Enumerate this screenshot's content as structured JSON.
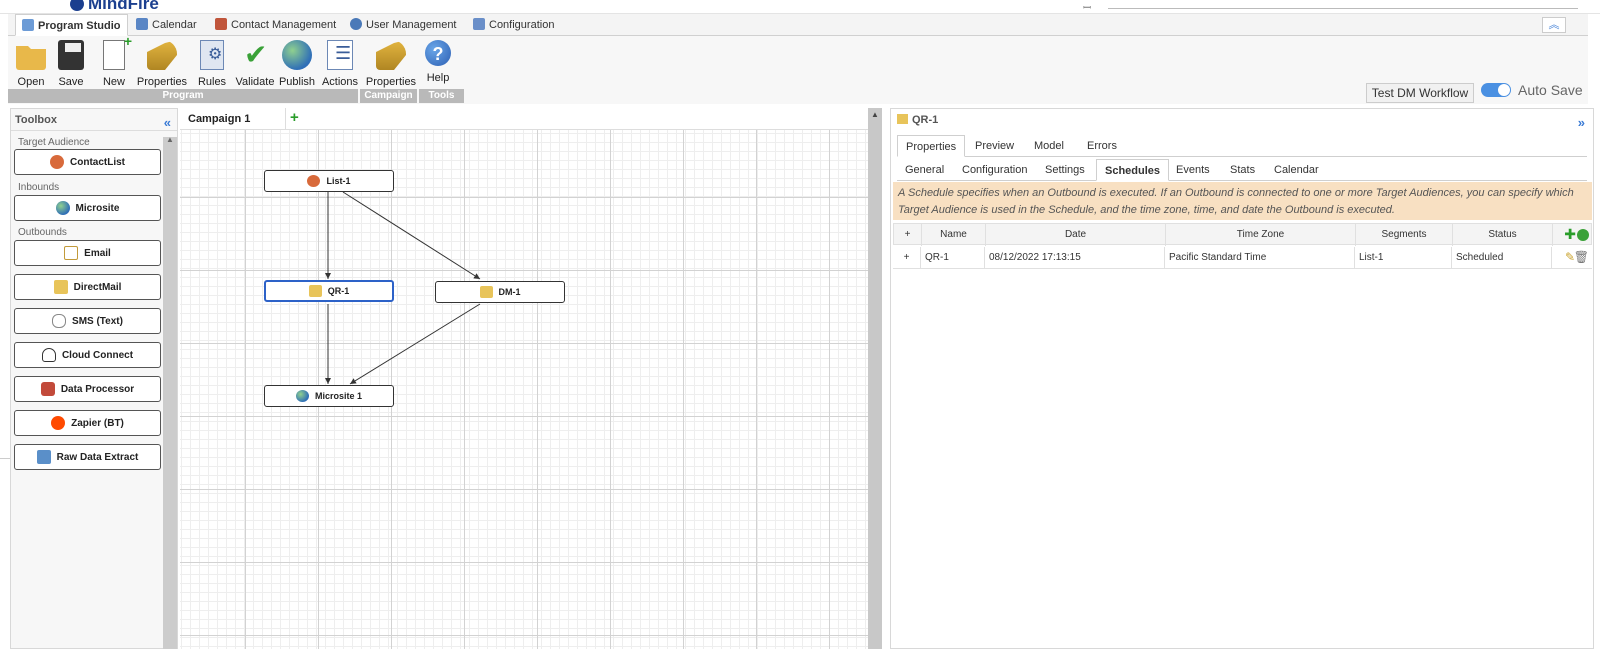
{
  "app": {
    "logo_text": "MindFire",
    "search_placeholder": ""
  },
  "top_tabs": [
    {
      "label": "Program Studio",
      "color": "#3a7bd5"
    },
    {
      "label": "Calendar",
      "color": "#5a86c5"
    },
    {
      "label": "Contact Management",
      "color": "#c0553b"
    },
    {
      "label": "User Management",
      "color": "#4a79b8"
    },
    {
      "label": "Configuration",
      "color": "#6a8fc9"
    }
  ],
  "ribbon": {
    "buttons": [
      {
        "label": "Open",
        "icon": "folder-icon"
      },
      {
        "label": "Save",
        "icon": "floppy-icon"
      },
      {
        "label": "New",
        "icon": "new-file-icon"
      },
      {
        "label": "Properties",
        "icon": "properties-icon"
      },
      {
        "label": "Rules",
        "icon": "rules-icon"
      },
      {
        "label": "Validate",
        "icon": "checkmark-icon"
      },
      {
        "label": "Publish",
        "icon": "globe-icon"
      },
      {
        "label": "Actions",
        "icon": "actions-icon"
      },
      {
        "label": "Properties",
        "icon": "properties-icon"
      },
      {
        "label": "Help",
        "icon": "help-icon"
      }
    ],
    "groups": [
      "Program",
      "Campaign",
      "Tools"
    ],
    "test_button": "Test DM Workflow",
    "auto_save_label": "Auto Save",
    "auto_save_on": true
  },
  "toolbox": {
    "title": "Toolbox",
    "sections": [
      {
        "label": "Target Audience",
        "items": [
          "ContactList"
        ]
      },
      {
        "label": "Inbounds",
        "items": [
          "Microsite"
        ]
      },
      {
        "label": "Outbounds",
        "items": [
          "Email",
          "DirectMail",
          "SMS (Text)",
          "Cloud Connect",
          "Data Processor",
          "Zapier (BT)",
          "Raw Data Extract"
        ]
      }
    ]
  },
  "canvas": {
    "tab_label": "Campaign 1",
    "nodes": [
      "List-1",
      "QR-1",
      "DM-1",
      "Microsite 1"
    ]
  },
  "panel": {
    "title": "QR-1",
    "tabs": [
      "Properties",
      "Preview",
      "Model",
      "Errors"
    ],
    "active_tab": "Properties",
    "subtabs": [
      "General",
      "Configuration",
      "Settings",
      "Schedules",
      "Events",
      "Stats",
      "Calendar"
    ],
    "active_subtab": "Schedules",
    "info_text": "A Schedule specifies when an Outbound is executed. If an Outbound is connected to one or more Target Audiences, you can specify which Target Audience is used in the Schedule, and the time zone, time, and date the Outbound is executed.",
    "columns": [
      "+",
      "Name",
      "Date",
      "Time Zone",
      "Segments",
      "Status"
    ],
    "rows": [
      {
        "expand": "+",
        "name": "QR-1",
        "date": "08/12/2022 17:13:15",
        "timezone": "Pacific Standard Time",
        "segments": "List-1",
        "status": "Scheduled"
      }
    ]
  },
  "colors": {
    "accent": "#3a7bd5",
    "annotation": "#e8101c",
    "info_bg": "#f8e0c2"
  }
}
